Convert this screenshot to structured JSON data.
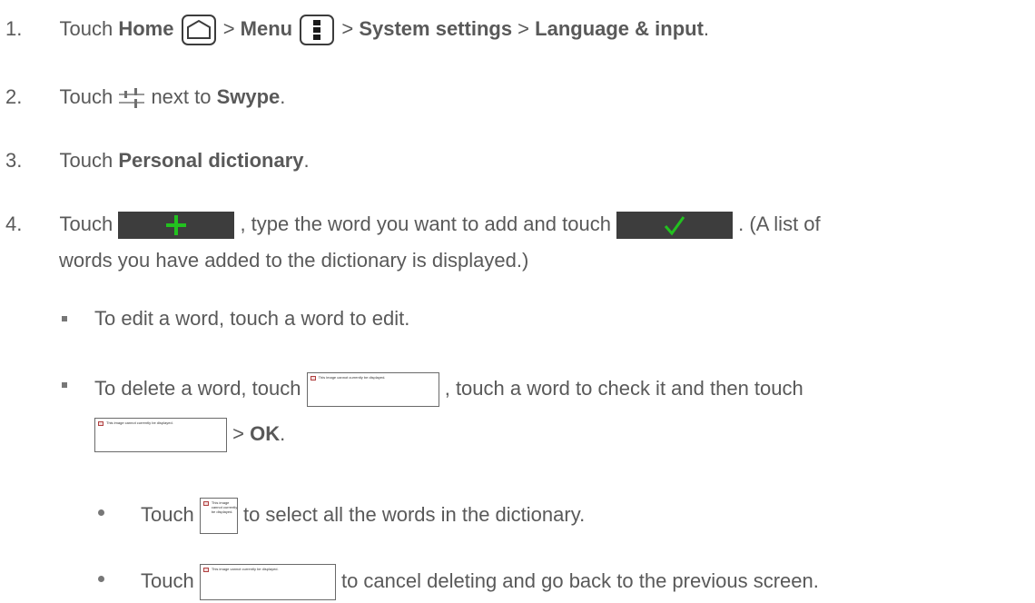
{
  "steps": [
    {
      "num": "1.",
      "t1": "Touch ",
      "b1": "Home",
      "t2": " > ",
      "b2": "Menu",
      "t3": " > ",
      "b3": "System settings",
      "t4": " > ",
      "b4": "Language & input",
      "t5": "."
    },
    {
      "num": "2.",
      "t1": "Touch ",
      "t2": " next to ",
      "b1": "Swype",
      "t3": "."
    },
    {
      "num": "3.",
      "t1": "Touch ",
      "b1": "Personal dictionary",
      "t2": "."
    },
    {
      "num": "4.",
      "t1": "Touch ",
      "t2": ", type the word you want to add and touch ",
      "t3": ". (A list of",
      "t4": "words you have added to the dictionary is displayed.)"
    }
  ],
  "bullets": [
    {
      "text": "To edit a word, touch a word to edit."
    },
    {
      "t1": "To delete a word, touch ",
      "t2": ", touch a word to check it and then touch",
      "t3": " > ",
      "b1": "OK",
      "t4": "."
    }
  ],
  "subbullets": [
    {
      "t1": "Touch ",
      "t2": " to select all the words in the dictionary."
    },
    {
      "t1": "Touch ",
      "t2": " to cancel deleting and go back to the previous screen."
    }
  ],
  "broken_image_texts": {
    "delete": "This image cannot currently be displayed.",
    "confirm": "This image cannot currently be displayed.",
    "select_all": "This image cannot currently be displayed.",
    "cancel": "This image cannot currently be displayed."
  },
  "icons": {
    "home": "home-icon",
    "menu": "menu-icon",
    "settings": "settings-sliders-icon",
    "add": "plus-icon",
    "done": "checkmark-icon"
  },
  "colors": {
    "text": "#595959",
    "icon_green": "#22c11f",
    "dark_button": "#3d3d3d"
  }
}
